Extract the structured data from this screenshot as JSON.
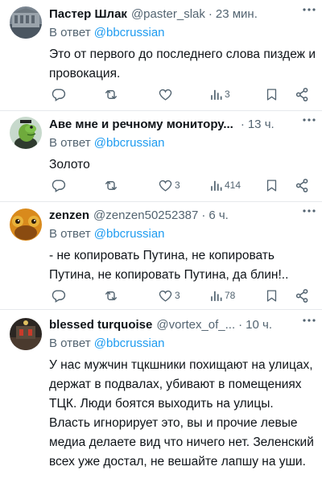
{
  "tweets": [
    {
      "name": "Пастер Шлак",
      "handle": "@paster_slak",
      "dot": "·",
      "time": "23 мин.",
      "reply_prefix": "В ответ",
      "reply_handle": "@bbcrussian",
      "text": "Это от первого до последнего слова пиздеж и провокация.",
      "replies": "",
      "retweets": "",
      "likes": "",
      "views": "3"
    },
    {
      "name": "Аве мне и речному монитору...",
      "handle": "",
      "dot": "·",
      "time": "13 ч.",
      "reply_prefix": "В ответ",
      "reply_handle": "@bbcrussian",
      "text": "Золото",
      "replies": "",
      "retweets": "",
      "likes": "3",
      "views": "414"
    },
    {
      "name": "zenzen",
      "handle": "@zenzen50252387",
      "dot": "·",
      "time": "6 ч.",
      "reply_prefix": "В ответ",
      "reply_handle": "@bbcrussian",
      "text": "- не копировать Путина, не копировать Путина, не копировать Путина, да блин!..",
      "replies": "",
      "retweets": "",
      "likes": "3",
      "views": "78"
    },
    {
      "name": "blessed turquoise",
      "handle": "@vortex_of_...",
      "dot": "·",
      "time": "10 ч.",
      "reply_prefix": "В ответ",
      "reply_handle": "@bbcrussian",
      "text": "У нас мужчин тцкшники похищают  на улицах, держат в подвалах, убивают в помещениях ТЦК. Люди боятся выходить на улицы. Власть игнорирует это, вы и прочие левые медиа делаете вид что ничего нет. Зеленский всех уже достал, не вешайте лапшу на уши."
    }
  ],
  "icons": {
    "reply": "reply-icon",
    "retweet": "retweet-icon",
    "like": "heart-icon",
    "views": "views-icon",
    "bookmark": "bookmark-icon",
    "share": "share-icon",
    "more": "more-icon"
  },
  "colors": {
    "link": "#1d9bf0",
    "muted": "#536471",
    "text": "#0f1419",
    "divider": "#e6e9ec"
  }
}
